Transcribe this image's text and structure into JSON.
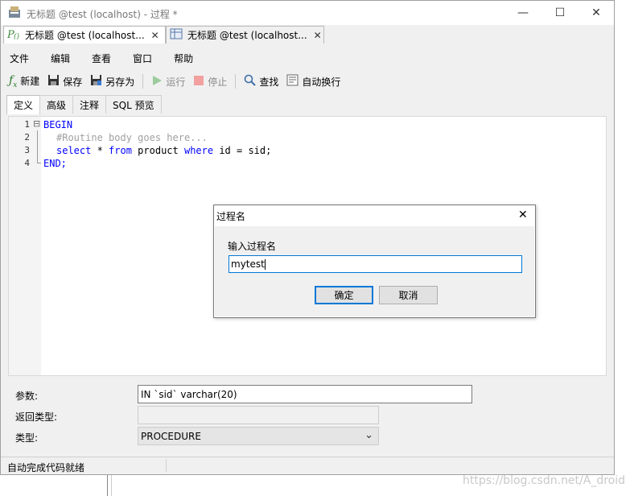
{
  "window": {
    "title": "无标题 @test (localhost) - 过程 *",
    "minimize_glyph": "—",
    "maximize_glyph": "☐",
    "close_glyph": "✕"
  },
  "doc_tabs": [
    {
      "label": "无标题 @test (localhost...",
      "close": "✕",
      "icon": "procedure-icon"
    },
    {
      "label": "无标题 @test (localhost...",
      "close": "✕",
      "icon": "table-icon"
    }
  ],
  "menu": [
    "文件",
    "编辑",
    "查看",
    "窗口",
    "帮助"
  ],
  "toolbar": {
    "new": "新建",
    "save": "保存",
    "save_as": "另存为",
    "run": "运行",
    "stop": "停止",
    "find": "查找",
    "word_wrap": "自动换行",
    "fx_glyph": "ƒ",
    "fx_sub": "x"
  },
  "subtabs": [
    "定义",
    "高级",
    "注释",
    "SQL 预览"
  ],
  "editor": {
    "line_numbers": [
      "1",
      "2",
      "3",
      "4"
    ],
    "fold_glyph": "⊟",
    "line1": "BEGIN",
    "line2": "#Routine body goes here...",
    "line3_kw1": "select",
    "line3_a": " * ",
    "line3_kw2": "from",
    "line3_b": " product ",
    "line3_kw3": "where",
    "line3_c": " id = sid;",
    "line4": "END;"
  },
  "dialog": {
    "title": "过程名",
    "close_glyph": "✕",
    "prompt": "输入过程名",
    "value": "mytest",
    "ok": "确定",
    "cancel": "取消"
  },
  "fields": {
    "params_label": "参数:",
    "params_value": "IN `sid` varchar(20)",
    "return_label": "返回类型:",
    "type_label": "类型:",
    "type_value": "PROCEDURE",
    "type_arrow": "⌄"
  },
  "status": {
    "text": "自动完成代码就绪"
  },
  "watermark": "https://blog.csdn.net/A_droid"
}
